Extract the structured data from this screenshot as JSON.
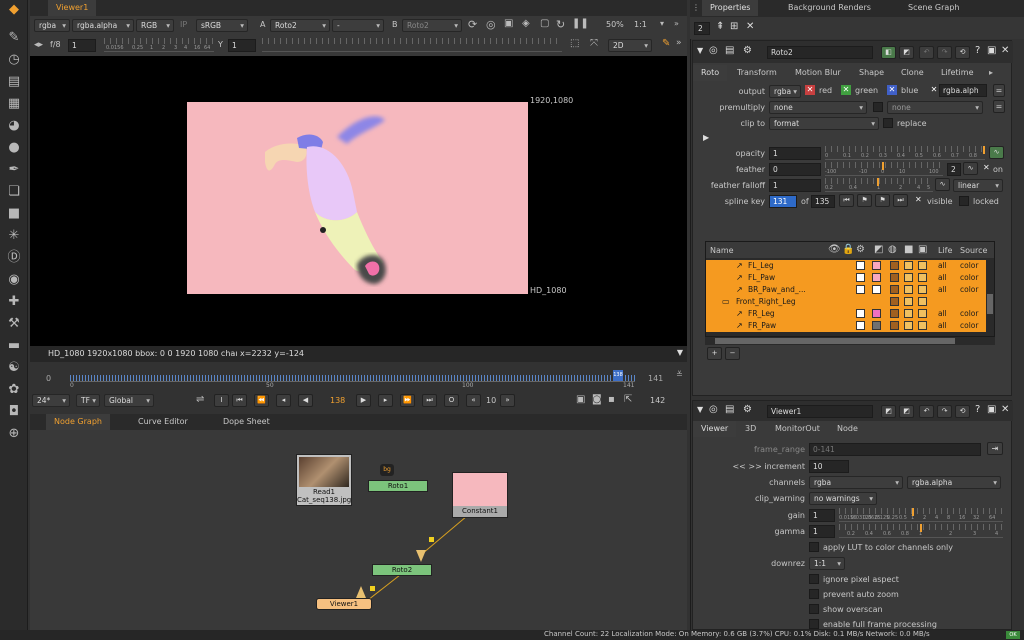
{
  "toolbar_icons": [
    "paint-brush",
    "clock",
    "grid",
    "film",
    "pie",
    "circle",
    "pen",
    "layers",
    "cube",
    "sparkle",
    "d-letter",
    "eye",
    "puzzle",
    "wrench",
    "stack",
    "swirl",
    "flower",
    "barrel",
    "globe"
  ],
  "viewer": {
    "tab": "Viewer1",
    "row1": {
      "channels": "rgba",
      "alpha": "rgba.alpha",
      "colorspace": "RGB",
      "ip": "IP",
      "lut": "sRGB",
      "a_label": "A",
      "a_input": "Roto2",
      "dash": "-",
      "b_label": "B",
      "b_input": "Roto2",
      "zoom": "50%",
      "ratio": "1:1"
    },
    "row2": {
      "fstop": "f/8",
      "frame": "1",
      "gain_ticks": [
        "0.0156",
        "0.25",
        "1",
        "2",
        "3",
        "4",
        "16",
        "64"
      ],
      "y_label": "Y",
      "y_value": "1",
      "view": "2D"
    },
    "format_label": "1920,1080",
    "format_name": "HD_1080",
    "info": "HD_1080 1920x1080  bbox: 0 0 1920 1080 chaı  x=2232 y=-124",
    "timeline": {
      "start": "0",
      "end": "141",
      "ticks": [
        "0",
        "50",
        "100",
        "141"
      ],
      "current_tick": "138"
    },
    "playback": {
      "fps": "24*",
      "tf": "TF",
      "scope": "Global",
      "frame": "138",
      "step": "10",
      "end_frame": "142"
    }
  },
  "bottom_tabs": [
    "Node Graph",
    "Curve Editor",
    "Dope Sheet"
  ],
  "nodes": {
    "read": "Read1",
    "read_file": "Cat_seq138.jpg",
    "roto1": "Roto1",
    "constant": "Constant1",
    "roto2": "Roto2",
    "viewer": "Viewer1",
    "bg": "bg"
  },
  "right_tabs": [
    "Properties",
    "Background Renders",
    "Scene Graph"
  ],
  "props_count": "2",
  "roto": {
    "name": "Roto2",
    "tabs": [
      "Roto",
      "Transform",
      "Motion Blur",
      "Shape",
      "Clone",
      "Lifetime"
    ],
    "output_label": "output",
    "output": "rgba",
    "red": "red",
    "green": "green",
    "blue": "blue",
    "output_alpha": "rgba.alph",
    "premultiply_label": "premultiply",
    "premultiply": "none",
    "premultiply2": "none",
    "clip_label": "clip to",
    "clip": "format",
    "replace": "replace",
    "opacity_label": "opacity",
    "opacity": "1",
    "opacity_ticks": [
      "0",
      "0.1",
      "0.2",
      "0.3",
      "0.4",
      "0.5",
      "0.6",
      "0.7",
      "0.8"
    ],
    "feather_label": "feather",
    "feather": "0",
    "feather_ticks": [
      "-100",
      "-10",
      "0",
      "10",
      "100"
    ],
    "feather_on": "on",
    "feather_num": "2",
    "falloff_label": "feather falloff",
    "falloff": "1",
    "falloff_ticks": [
      "0.2",
      "0.4",
      "1",
      "2",
      "4",
      "5"
    ],
    "falloff_mode": "linear",
    "spline_label": "spline key",
    "spline_key": "131",
    "of": "of",
    "spline_total": "135",
    "visible": "visible",
    "locked": "locked",
    "columns": [
      "Name",
      "Life",
      "Source"
    ],
    "rows": [
      {
        "name": "FL_Leg",
        "life": "all",
        "source": "color"
      },
      {
        "name": "FL_Paw",
        "life": "all",
        "source": "color"
      },
      {
        "name": "BR_Paw_and_...",
        "life": "all",
        "source": "color"
      },
      {
        "name": "Front_Right_Leg",
        "life": "",
        "source": ""
      },
      {
        "name": "FR_Leg",
        "life": "all",
        "source": "color"
      },
      {
        "name": "FR_Paw",
        "life": "all",
        "source": "color"
      }
    ]
  },
  "viewer_props": {
    "name": "Viewer1",
    "tabs": [
      "Viewer",
      "3D",
      "MonitorOut",
      "Node"
    ],
    "frame_range_label": "frame_range",
    "frame_range": "0-141",
    "increment_label": "<< >> increment",
    "increment": "10",
    "channels_label": "channels",
    "channels": "rgba",
    "channels_alpha": "rgba.alpha",
    "clip_warning_label": "clip_warning",
    "clip_warning": "no warnings",
    "gain_label": "gain",
    "gain": "1",
    "gain_ticks": [
      "0.0156",
      "0.03125",
      "0.0625",
      "0.125",
      "0.25",
      "0.5",
      "1",
      "2",
      "4",
      "8",
      "16",
      "32",
      "64"
    ],
    "gamma_label": "gamma",
    "gamma": "1",
    "gamma_ticks": [
      "0.2",
      "0.4",
      "0.6",
      "0.8",
      "1",
      "2",
      "3",
      "4"
    ],
    "apply_lut": "apply LUT to color channels only",
    "downrez_label": "downrez",
    "downrez": "1:1",
    "checks": [
      "ignore pixel aspect",
      "prevent auto zoom",
      "show overscan",
      "enable full frame processing"
    ]
  },
  "status": "Channel Count: 22  Localization Mode: On  Memory: 0.6 GB (3.7%)  CPU: 0.1%  Disk: 0.1 MB/s  Network: 0.0 MB/s",
  "status_badge": "OK"
}
